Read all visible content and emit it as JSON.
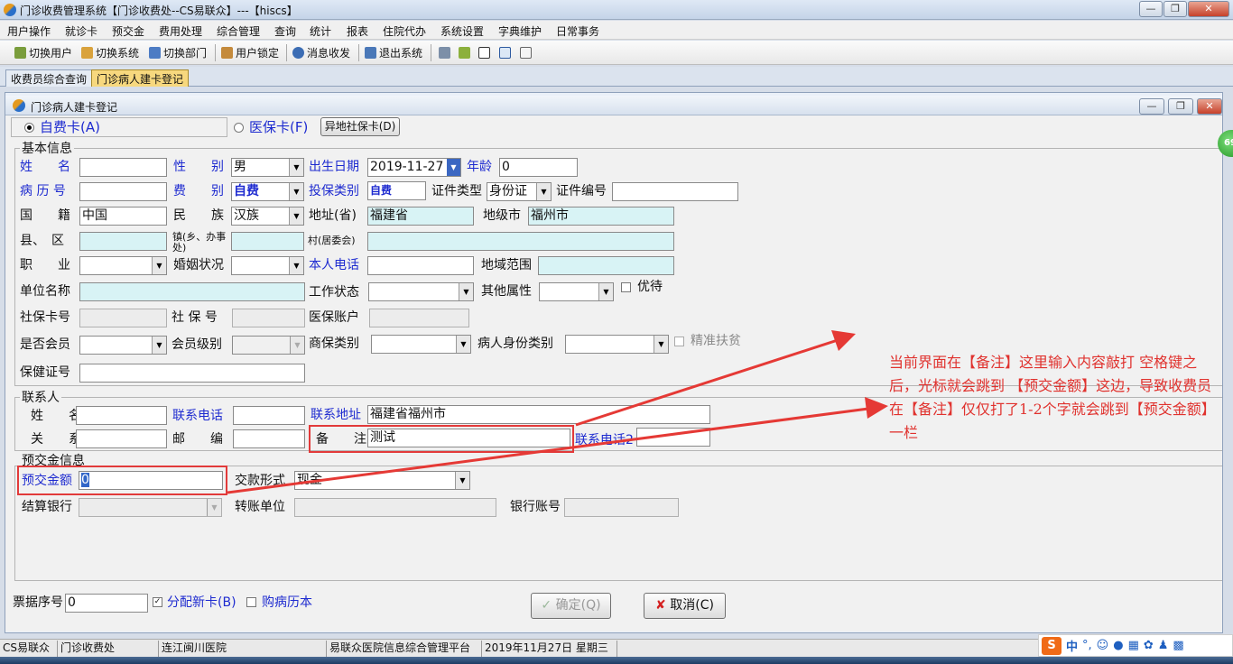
{
  "window": {
    "title": "门诊收费管理系统【门诊收费处--CS易联众】---【hiscs】",
    "minimize": "—",
    "restore": "❐",
    "close": "✕"
  },
  "menu": [
    "用户操作",
    "就诊卡",
    "预交金",
    "费用处理",
    "综合管理",
    "查询",
    "统计",
    "报表",
    "住院代办",
    "系统设置",
    "字典维护",
    "日常事务"
  ],
  "toolbar": {
    "switch_user": "切换用户",
    "switch_system": "切换系统",
    "switch_dept": "切换部门",
    "lock_user": "用户锁定",
    "msg": "消息收发",
    "exit": "退出系统"
  },
  "tabs": [
    "收费员综合查询",
    "门诊病人建卡登记"
  ],
  "subwindow": {
    "title": "门诊病人建卡登记"
  },
  "card": {
    "self_pay": "自费卡(A)",
    "insurance": "医保卡(F)",
    "remote_btn": "异地社保卡(D)"
  },
  "basic": {
    "section": "基本信息",
    "name_lbl": "姓　　名",
    "gender_lbl": "性　　别",
    "gender": "男",
    "dob_lbl": "出生日期",
    "dob": "2019-11-27",
    "age_lbl": "年龄",
    "age": "0",
    "record_lbl": "病 历 号",
    "fee_lbl": "费　　别",
    "fee": "自费",
    "ins_lbl": "投保类别",
    "ins": "自费",
    "idtype_lbl": "证件类型",
    "idtype": "身份证",
    "idno_lbl": "证件编号",
    "nation_lbl": "国　　籍",
    "nation": "中国",
    "ethnic_lbl": "民　　族",
    "ethnic": "汉族",
    "prov_lbl": "地址(省)",
    "prov": "福建省",
    "city_lbl": "地级市",
    "city": "福州市",
    "county_lbl": "县、　区",
    "town_lbl": "镇(乡、办事处)",
    "village_lbl": "村(居委会)",
    "job_lbl": "职　　业",
    "marital_lbl": "婚姻状况",
    "phone_lbl": "本人电话",
    "area_lbl": "地域范围",
    "unit_lbl": "单位名称",
    "work_lbl": "工作状态",
    "other_lbl": "其他属性",
    "priority_lbl": "优待",
    "sscard_lbl": "社保卡号",
    "ssno_lbl": "社 保 号",
    "account_lbl": "医保账户",
    "member_lbl": "是否会员",
    "level_lbl": "会员级别",
    "commercial_lbl": "商保类别",
    "identity_lbl": "病人身份类别",
    "poverty_lbl": "精准扶贫",
    "health_lbl": "保健证号"
  },
  "contact": {
    "section": "联系人",
    "name_lbl": "姓　　名",
    "tel_lbl": "联系电话",
    "addr_lbl": "联系地址",
    "addr": "福建省福州市",
    "rel_lbl": "关　　系",
    "zip_lbl": "邮　　编",
    "note_lbl": "备　　注",
    "note": "测试",
    "tel2_lbl": "联系电话2"
  },
  "deposit": {
    "section": "预交金信息",
    "amount_lbl": "预交金额",
    "amount": "0",
    "pay_lbl": "交款形式",
    "pay": "现金",
    "bank_lbl": "结算银行",
    "transfer_lbl": "转账单位",
    "account_lbl": "银行账号"
  },
  "footer": {
    "receipt_lbl": "票据序号",
    "receipt": "0",
    "newcard": "分配新卡(B)",
    "history": "购病历本",
    "ok": "确定(Q)",
    "cancel": "取消(C)"
  },
  "annotation": "当前界面在【备注】这里输入内容敲打 空格键之后，光标就会跳到 【预交金额】这边，导致收费员在【备注】仅仅打了1-2个字就会跳到【预交金额】一栏",
  "status": [
    "CS易联众",
    "门诊收费处",
    "连江闽川医院",
    "易联众医院信息综合管理平台",
    "2019年11月27日 星期三"
  ],
  "ime": {
    "logo": "S",
    "lang": "中"
  },
  "badge": "69",
  "colors": {
    "annotation_red": "#e23a3a",
    "label_blue": "#1e2bd0"
  }
}
